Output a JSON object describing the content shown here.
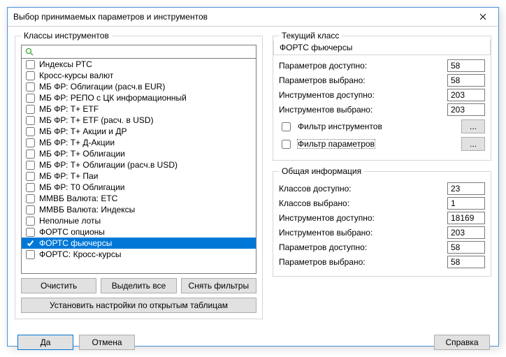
{
  "title": "Выбор принимаемых параметров и инструментов",
  "left": {
    "legend": "Классы инструментов",
    "search_placeholder": "",
    "items": [
      {
        "label": "Индексы РТС",
        "checked": false,
        "selected": false
      },
      {
        "label": "Кросс-курсы валют",
        "checked": false,
        "selected": false
      },
      {
        "label": "МБ ФР: Облигации (расч.в EUR)",
        "checked": false,
        "selected": false
      },
      {
        "label": "МБ ФР: РЕПО с ЦК информационный",
        "checked": false,
        "selected": false
      },
      {
        "label": "МБ ФР: T+ ETF",
        "checked": false,
        "selected": false
      },
      {
        "label": "МБ ФР: T+ ETF (расч. в USD)",
        "checked": false,
        "selected": false
      },
      {
        "label": "МБ ФР: T+ Акции и ДР",
        "checked": false,
        "selected": false
      },
      {
        "label": "МБ ФР: T+ Д-Акции",
        "checked": false,
        "selected": false
      },
      {
        "label": "МБ ФР: T+ Облигации",
        "checked": false,
        "selected": false
      },
      {
        "label": "МБ ФР: T+ Облигации (расч.в USD)",
        "checked": false,
        "selected": false
      },
      {
        "label": "МБ ФР: T+ Паи",
        "checked": false,
        "selected": false
      },
      {
        "label": "МБ ФР: T0 Облигации",
        "checked": false,
        "selected": false
      },
      {
        "label": "ММВБ Валюта: ETC",
        "checked": false,
        "selected": false
      },
      {
        "label": "ММВБ Валюта: Индексы",
        "checked": false,
        "selected": false
      },
      {
        "label": "Неполные лоты",
        "checked": false,
        "selected": false
      },
      {
        "label": "ФОРТС опционы",
        "checked": false,
        "selected": false
      },
      {
        "label": "ФОРТС фьючерсы",
        "checked": true,
        "selected": true
      },
      {
        "label": "ФОРТС: Кросс-курсы",
        "checked": false,
        "selected": false
      }
    ],
    "btn_clear": "Очистить",
    "btn_selectall": "Выделить все",
    "btn_resetfilters": "Снять фильтры",
    "btn_apply_open": "Установить настройки по открытым  таблицам"
  },
  "current": {
    "legend": "Текущий класс",
    "class_name": "ФОРТС фьючерсы",
    "params_avail_lbl": "Параметров доступно:",
    "params_avail_val": "58",
    "params_sel_lbl": "Параметров выбрано:",
    "params_sel_val": "58",
    "instr_avail_lbl": "Инструментов доступно:",
    "instr_avail_val": "203",
    "instr_sel_lbl": "Инструментов выбрано:",
    "instr_sel_val": "203",
    "filter_instr": "Фильтр инструментов",
    "filter_params": "Фильтр параметров",
    "dots": "..."
  },
  "general": {
    "legend": "Общая информация",
    "cls_avail_lbl": "Классов доступно:",
    "cls_avail_val": "23",
    "cls_sel_lbl": "Классов выбрано:",
    "cls_sel_val": "1",
    "instr_avail_lbl": "Инструментов доступно:",
    "instr_avail_val": "18169",
    "instr_sel_lbl": "Инструментов выбрано:",
    "instr_sel_val": "203",
    "params_avail_lbl": "Параметров доступно:",
    "params_avail_val": "58",
    "params_sel_lbl": "Параметров выбрано:",
    "params_sel_val": "58"
  },
  "footer": {
    "ok": "Да",
    "cancel": "Отмена",
    "help": "Справка"
  }
}
